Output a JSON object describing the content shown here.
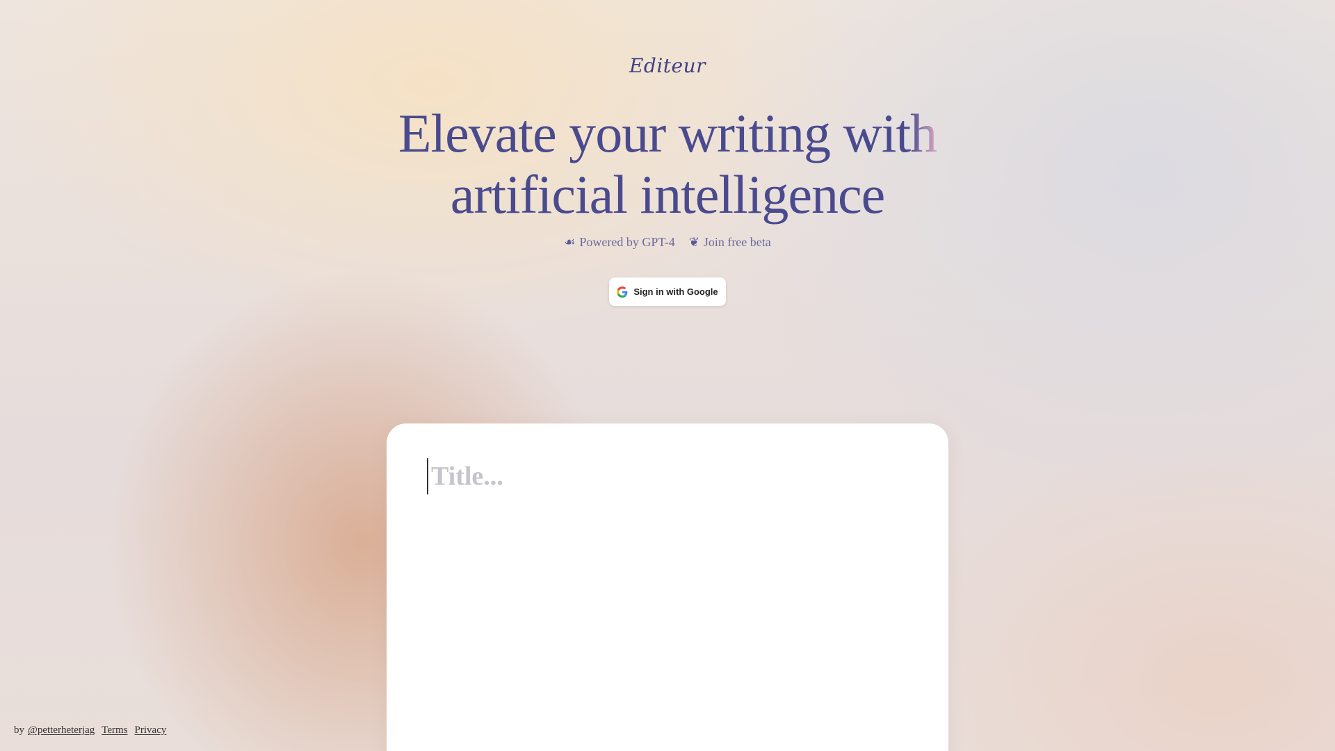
{
  "brand": {
    "logo_text": "Editeur"
  },
  "hero": {
    "headline_line1_main": "Elevate your writing wit",
    "headline_line1_fade": "h",
    "headline_line2": "artificial intelligence"
  },
  "features": [
    {
      "icon": "leaf-icon",
      "glyph": "☙",
      "label": "Powered by GPT-4"
    },
    {
      "icon": "flourish-icon",
      "glyph": "❦",
      "label": "Join free beta"
    }
  ],
  "auth": {
    "signin_label": "Sign in with Google"
  },
  "editor": {
    "title_placeholder": "Title..."
  },
  "footer": {
    "by_text": "by",
    "author_handle": "@petterheterjag",
    "terms_label": "Terms",
    "privacy_label": "Privacy"
  },
  "colors": {
    "accent": "#4a4a8e",
    "headline_fade": "#d9a8c6",
    "button_bg": "#ffffff"
  }
}
